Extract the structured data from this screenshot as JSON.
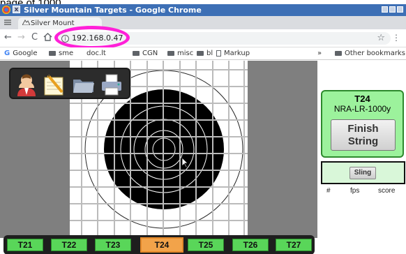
{
  "caption": "page of 1000",
  "window": {
    "title": "Silver Mountain Targets - Google Chrome",
    "close_glyph": "x"
  },
  "tab": {
    "label": "Silver Mount"
  },
  "address": {
    "url": "192.168.0.47",
    "info_glyph": "i"
  },
  "bookmarks": {
    "items": [
      "Google",
      "sme",
      "doc.lt",
      "CGN",
      "misc",
      "bl",
      "Markup"
    ],
    "overflow": "»",
    "other": "Other bookmarks"
  },
  "tools": {
    "icons": [
      "user-icon",
      "notepad-icon",
      "folder-icon",
      "printer-icon"
    ]
  },
  "target_buttons": [
    "T21",
    "T22",
    "T23",
    "T24",
    "T25",
    "T26",
    "T27"
  ],
  "active_target": "T24",
  "info": {
    "target_name": "T24",
    "course": "NRA-LR-1000y",
    "finish_line1": "Finish",
    "finish_line2": "String",
    "sling_label": "Sling"
  },
  "shot_table": {
    "headers": [
      "#",
      "fps",
      "score"
    ]
  },
  "colors": {
    "titlebar": "#3d6fb5",
    "annotation": "#ff20d8",
    "button_green": "#59d659",
    "active_button": "#f2a34a",
    "info_panel": "#9cf29c"
  }
}
